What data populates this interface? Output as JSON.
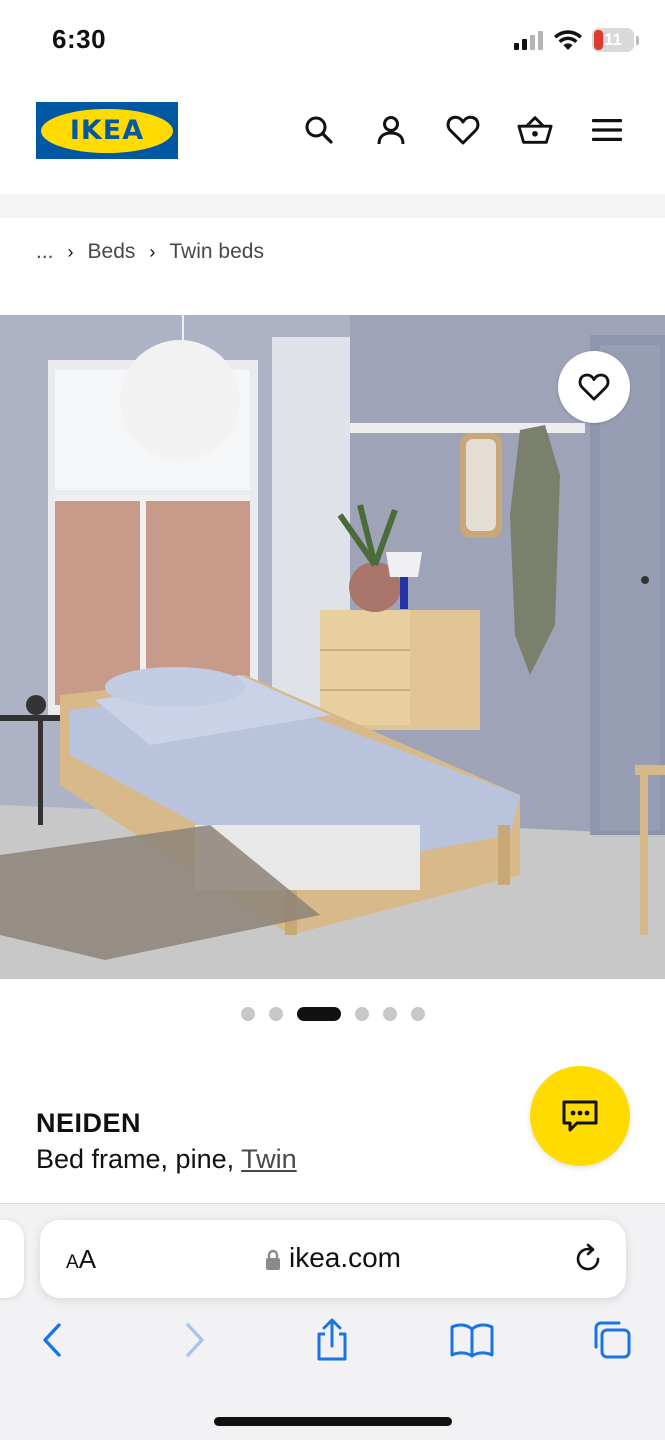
{
  "status_bar": {
    "time": "6:30",
    "battery": "11"
  },
  "header": {
    "logo_text": "IKEA",
    "icons": [
      "search-icon",
      "account-icon",
      "heart-icon",
      "cart-icon",
      "menu-icon"
    ]
  },
  "breadcrumb": {
    "ellipsis": "...",
    "items": [
      "Beds",
      "Twin beds"
    ]
  },
  "gallery": {
    "slide_count": 6,
    "active_slide": 3
  },
  "product": {
    "name": "NEIDEN",
    "description": "Bed frame, pine, ",
    "size_link": "Twin"
  },
  "browser": {
    "aa_label": "AA",
    "url": "ikea.com"
  },
  "colors": {
    "ikea_blue": "#0058a3",
    "ikea_yellow": "#ffdb00",
    "ios_blue": "#1a73e8"
  }
}
